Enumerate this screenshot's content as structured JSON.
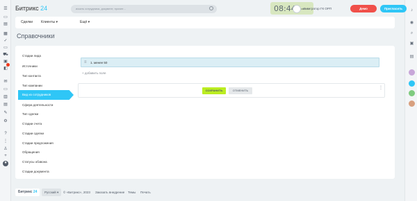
{
  "header": {
    "logo_name": "Битрикс",
    "logo_num": "24",
    "search_placeholder": "искать сотрудника, документ, прочее...",
    "clock": "08:44",
    "clock_status": "В начало",
    "user_name": "Интегратор ГК ОРП",
    "demo_label": "Демо",
    "invite_label": "Пригласить"
  },
  "menubar": {
    "items": [
      {
        "label": "Сделки"
      },
      {
        "label": "Клиенты"
      },
      {
        "label": "Ещё"
      }
    ]
  },
  "page": {
    "title": "Справочники"
  },
  "nav": {
    "items": [
      {
        "label": "Стадии лида"
      },
      {
        "label": "Источники"
      },
      {
        "label": "Тип контакта"
      },
      {
        "label": "Тип компании"
      },
      {
        "label": "Вид из сотрудников"
      },
      {
        "label": "Сфера деятельности"
      },
      {
        "label": "Тип сделки"
      },
      {
        "label": "Стадии счета"
      },
      {
        "label": "Стадии сделки"
      },
      {
        "label": "Стадии предложения"
      },
      {
        "label": "Обращения"
      },
      {
        "label": "Статусы обзвона"
      },
      {
        "label": "Стадии документа"
      }
    ],
    "active_index": 4
  },
  "editor": {
    "field_value": "1. менее 50",
    "add_field_label": "+ добавить поле",
    "save_label": "СОХРАНИТЬ",
    "cancel_label": "ОТМЕНИТЬ"
  },
  "footer": {
    "brand_name": "Битрикс",
    "brand_num": "24",
    "language": "Русский",
    "links": [
      {
        "label": "© «Битрикс», 2023"
      },
      {
        "label": "Заказать внедрение"
      },
      {
        "label": "Темы"
      },
      {
        "label": "Печать"
      }
    ]
  },
  "colors": {
    "accent": "#2fc6f6",
    "save_button": "#bbed21",
    "demo_button": "#f0504a",
    "clock_bg": "#d8e7c0"
  }
}
